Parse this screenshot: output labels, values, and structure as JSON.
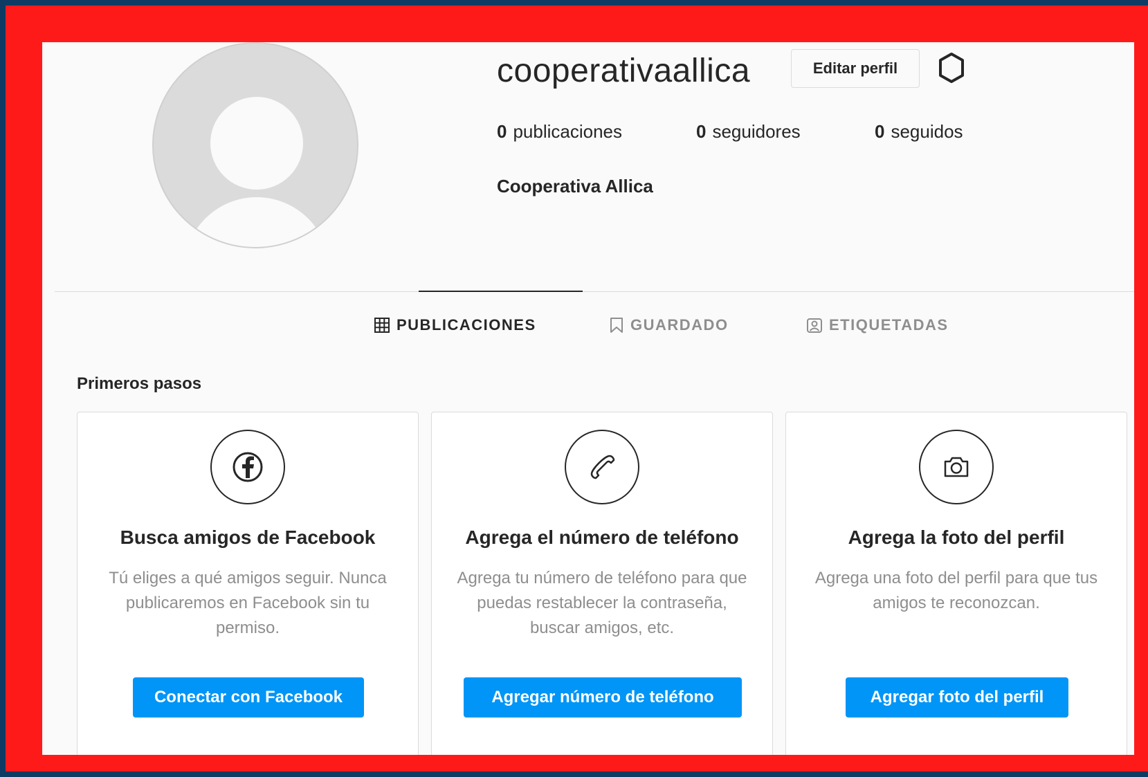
{
  "profile": {
    "username": "cooperativaallica",
    "edit_label": "Editar perfil",
    "full_name": "Cooperativa Allica",
    "stats": {
      "posts_count": "0",
      "posts_label": "publicaciones",
      "followers_count": "0",
      "followers_label": "seguidores",
      "following_count": "0",
      "following_label": "seguidos"
    }
  },
  "tabs": [
    {
      "label": "PUBLICACIONES",
      "icon": "grid-icon",
      "active": true
    },
    {
      "label": "GUARDADO",
      "icon": "bookmark-icon",
      "active": false
    },
    {
      "label": "ETIQUETADAS",
      "icon": "tagged-user-icon",
      "active": false
    }
  ],
  "onboarding": {
    "title": "Primeros pasos",
    "cards": [
      {
        "icon": "facebook-icon",
        "title": "Busca amigos de Facebook",
        "description": "Tú eliges a qué amigos seguir. Nunca publicaremos en Facebook sin tu permiso.",
        "button": "Conectar con Facebook"
      },
      {
        "icon": "phone-icon",
        "title": "Agrega el número de teléfono",
        "description": "Agrega tu número de teléfono para que puedas restablecer la contraseña, buscar amigos, etc.",
        "button": "Agregar número de teléfono"
      },
      {
        "icon": "camera-icon",
        "title": "Agrega la foto del perfil",
        "description": "Agrega una foto del perfil para que tus amigos te reconozcan.",
        "button": "Agregar foto del perfil"
      }
    ]
  },
  "colors": {
    "highlight_frame": "#ff1a1a",
    "outer_background": "#0d3b63",
    "primary_button": "#0095f6",
    "page_background": "#fafafa"
  }
}
